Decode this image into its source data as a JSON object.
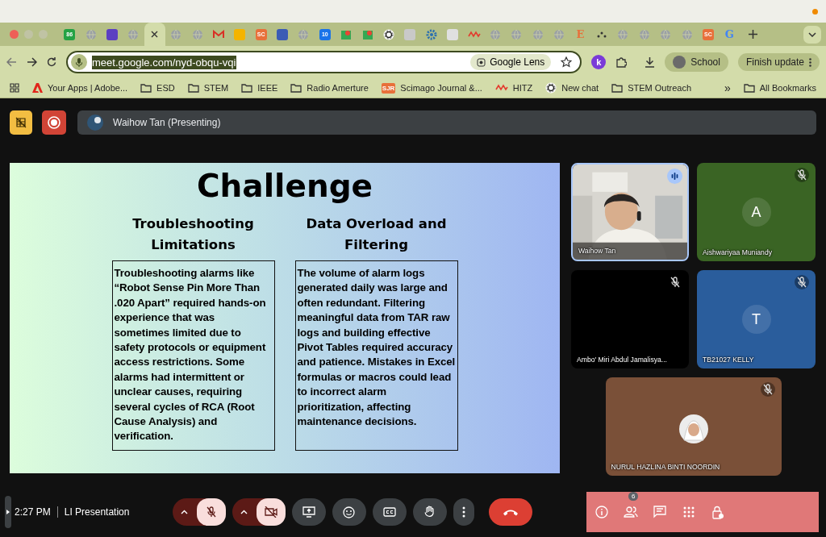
{
  "browser": {
    "tabs": [
      {
        "kind": "badge",
        "color": "#25a244",
        "text": "86",
        "selected": false
      },
      {
        "kind": "globe",
        "selected": false
      },
      {
        "kind": "tile",
        "color": "#5c3fc2",
        "selected": false
      },
      {
        "kind": "globe",
        "selected": false
      },
      {
        "kind": "close",
        "selected": true
      },
      {
        "kind": "globe",
        "selected": false
      },
      {
        "kind": "globe",
        "selected": false
      },
      {
        "kind": "mail",
        "selected": false
      },
      {
        "kind": "tile",
        "color": "#f4b400",
        "selected": false
      },
      {
        "kind": "badge",
        "color": "#e8703a",
        "text": "SC",
        "selected": false
      },
      {
        "kind": "tile",
        "color": "#3b5bb5",
        "selected": false
      },
      {
        "kind": "globe",
        "selected": false
      },
      {
        "kind": "badge",
        "color": "#1a73e8",
        "text": "10",
        "selected": false
      },
      {
        "kind": "pin",
        "color": "#34a853",
        "selected": false
      },
      {
        "kind": "pin",
        "color": "#34a853",
        "selected": false
      },
      {
        "kind": "knot",
        "selected": false
      },
      {
        "kind": "tile",
        "color": "#c9c9c9",
        "selected": false
      },
      {
        "kind": "gear",
        "color": "#2a6fb0",
        "selected": false
      },
      {
        "kind": "tile",
        "color": "#e0e0e0",
        "selected": false
      },
      {
        "kind": "squiggle",
        "color": "#e33b2e",
        "selected": false
      },
      {
        "kind": "globe",
        "selected": false
      },
      {
        "kind": "globe",
        "selected": false
      },
      {
        "kind": "globe",
        "selected": false
      },
      {
        "kind": "globe",
        "selected": false
      },
      {
        "kind": "letter",
        "color": "#e8703a",
        "text": "E",
        "selected": false
      },
      {
        "kind": "dots",
        "selected": false
      },
      {
        "kind": "globe",
        "selected": false
      },
      {
        "kind": "globe",
        "selected": false
      },
      {
        "kind": "globe",
        "selected": false
      },
      {
        "kind": "globe",
        "selected": false
      },
      {
        "kind": "badge",
        "color": "#e8703a",
        "text": "SC",
        "selected": false
      },
      {
        "kind": "letter",
        "color": "#4285f4",
        "text": "G",
        "selected": false
      }
    ],
    "address": {
      "value": "meet.google.com/nyd-obqu-vqi"
    },
    "lens_button": "Google Lens",
    "extension_letter": "k",
    "profile": "School",
    "update_button": "Finish update",
    "bookmarks": [
      {
        "kind": "adobe",
        "label": "Your Apps | Adobe..."
      },
      {
        "kind": "folder",
        "label": "ESD"
      },
      {
        "kind": "folder",
        "label": "STEM"
      },
      {
        "kind": "folder",
        "label": "IEEE"
      },
      {
        "kind": "folder",
        "label": "Radio Amerture"
      },
      {
        "kind": "badge",
        "badge": "SJR",
        "label": "Scimago Journal &..."
      },
      {
        "kind": "squiggle",
        "label": "HITZ"
      },
      {
        "kind": "knot",
        "label": "New chat"
      },
      {
        "kind": "folder",
        "label": "STEM Outreach"
      }
    ],
    "more_bookmarks": "»",
    "all_bookmarks": "All Bookmarks"
  },
  "meet": {
    "presenter_bar": "Waihow Tan (Presenting)",
    "slide": {
      "title": "Challenge",
      "columns": [
        {
          "heading": "Troubleshooting Limitations",
          "body": "Troubleshooting alarms like “Robot Sense Pin More Than .020 Apart” required hands-on experience that was sometimes limited due to safety protocols or equipment access restrictions. Some alarms had intermittent or unclear causes, requiring several cycles of RCA (Root Cause Analysis) and verification."
        },
        {
          "heading": "Data Overload and Filtering",
          "body": "The volume of alarm logs generated daily was large and often redundant. Filtering meaningful data from TAR raw logs and building effective Pivot Tables required accuracy and patience. Mistakes in Excel formulas or macros could lead to incorrect alarm prioritization, affecting maintenance decisions."
        }
      ]
    },
    "participants": [
      {
        "kind": "video",
        "name": "Waihow Tan",
        "speaking": true,
        "muted": false
      },
      {
        "kind": "initial",
        "name": "Aishwariyaa Muniandy",
        "initial": "A",
        "color": "#3a6424",
        "speaking": false,
        "muted": true
      },
      {
        "kind": "blank",
        "name": "Ambo' Miri Abdul Jamalisya...",
        "speaking": false,
        "muted": true
      },
      {
        "kind": "initial",
        "name": "TB21027 KELLY",
        "initial": "T",
        "color": "#2a5d9c",
        "speaking": false,
        "muted": true
      },
      {
        "name": "NURUL HAZLINA BINTI NOORDIN",
        "color": "#7a5038",
        "speaking": false,
        "muted": true
      }
    ],
    "clock": "2:27 PM",
    "meeting_name": "LI Presentation",
    "mic": {
      "muted": true
    },
    "camera": {
      "off": true
    },
    "people_count": "6"
  }
}
